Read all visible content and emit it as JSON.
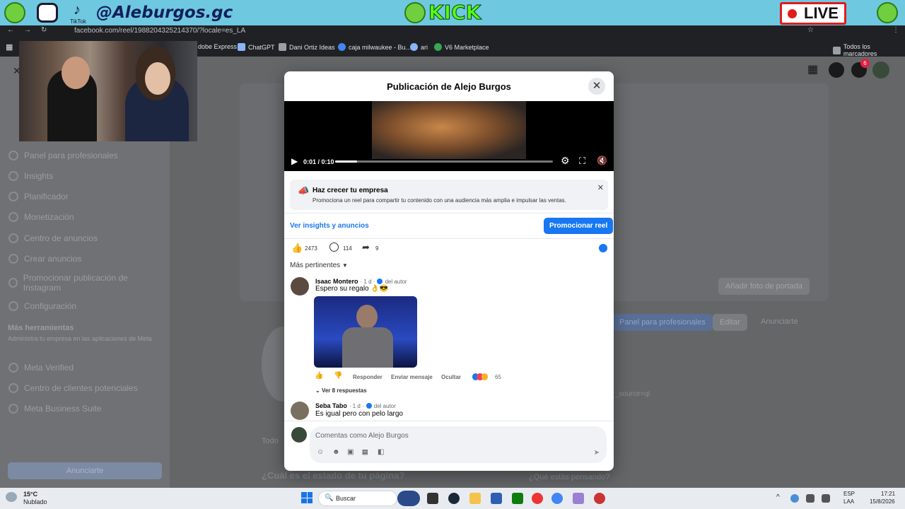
{
  "stream": {
    "handle": "@Aleburgos.gc",
    "tiktok": "TikTok",
    "kick": "KICK",
    "live": "LIVE"
  },
  "browser": {
    "url": "facebook.com/reel/1988204325214370/?locale=es_LA",
    "bookmarks": [
      "dobe Express",
      "ChatGPT",
      "Dani Ortiz Ideas",
      "caja milwaukee - Bu...",
      "ari",
      "V6 Marketplace"
    ],
    "all_bookmarks": "Todos los marcadores"
  },
  "fb_nav": {
    "notif_count": "6"
  },
  "sidebar": {
    "items": [
      {
        "label": "Panel para profesionales",
        "icon": "dashboard-icon"
      },
      {
        "label": "Insights",
        "icon": "insights-icon"
      },
      {
        "label": "Planificador",
        "icon": "calendar-icon"
      },
      {
        "label": "Monetización",
        "icon": "money-icon"
      },
      {
        "label": "Centro de anuncios",
        "icon": "megaphone-icon"
      },
      {
        "label": "Crear anuncios",
        "icon": "ad-icon"
      },
      {
        "label": "Promocionar publicación de Instagram",
        "icon": "instagram-icon"
      },
      {
        "label": "Configuración",
        "icon": "gear-icon"
      }
    ],
    "more_title": "Más herramientas",
    "more_sub": "Administra tu empresa en las aplicaciones de Meta",
    "more_items": [
      {
        "label": "Meta Verified"
      },
      {
        "label": "Centro de clientes potenciales"
      },
      {
        "label": "Meta Business Suite"
      }
    ],
    "cta": "Anunciarte"
  },
  "page_bg": {
    "add_cover": "Añadir foto de portada",
    "panel_btn": "Panel para profesionales",
    "edit_btn": "Editar",
    "advertise_btn": "Anunciarte",
    "tab_all": "Todo",
    "status_prompt": "¿Cuál es el estado de tu página?",
    "thinking": "¿Qué estás pensando?",
    "source": "_source=ql"
  },
  "modal": {
    "title": "Publicación de Alejo Burgos",
    "video": {
      "time": "0:01 / 0:10",
      "progress": 0.1
    },
    "promo": {
      "title": "Haz crecer tu empresa",
      "text": "Promociona un reel para compartir tu contenido con una audiencia más amplia e impulsar las ventas."
    },
    "insights_link": "Ver insights y anuncios",
    "promote_btn": "Promocionar reel",
    "stats": {
      "likes": "2473",
      "comments": "114",
      "shares": "9"
    },
    "sort": "Más pertinentes",
    "comments": [
      {
        "name": "Isaac Montero",
        "meta": "· 1 d ·",
        "author": "del autor",
        "text": "Espero su regalo 👌😎",
        "actions": {
          "reply": "Responder",
          "message": "Enviar mensaje",
          "hide": "Ocultar",
          "reactions": "65"
        },
        "replies": "Ver 8 respuestas"
      },
      {
        "name": "Seba Tabo",
        "meta": "· 1 d ·",
        "author": "del autor",
        "text": "Es igual pero con pelo largo"
      }
    ],
    "composer_placeholder": "Comentas como Alejo Burgos"
  },
  "taskbar": {
    "weather_temp": "15°C",
    "weather_desc": "Nublado",
    "search": "Buscar",
    "lang1": "ESP",
    "lang2": "LAA",
    "time": "17:21",
    "date": "15/8/2026"
  }
}
